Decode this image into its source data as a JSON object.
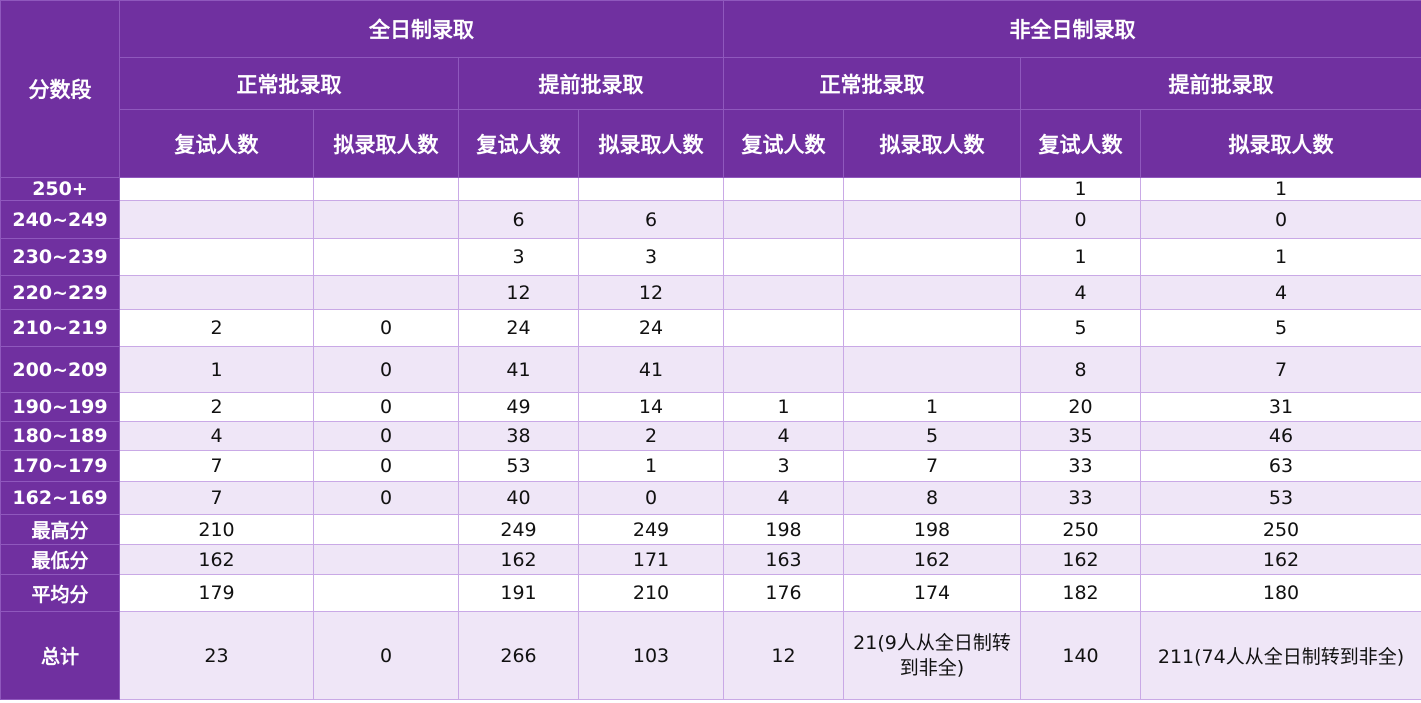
{
  "header": {
    "score_band": "分数段",
    "groups": [
      "全日制录取",
      "非全日制录取"
    ],
    "subgroups": [
      "正常批录取",
      "提前批录取",
      "正常批录取",
      "提前批录取"
    ],
    "columns": [
      "复试人数",
      "拟录取人数",
      "复试人数",
      "拟录取人数",
      "复试人数",
      "拟录取人数",
      "复试人数",
      "拟录取人数"
    ]
  },
  "rows": [
    {
      "label": "250+",
      "cells": [
        "",
        "",
        "",
        "",
        "",
        "",
        "1",
        "1"
      ]
    },
    {
      "label": "240~249",
      "cells": [
        "",
        "",
        "6",
        "6",
        "",
        "",
        "0",
        "0"
      ]
    },
    {
      "label": "230~239",
      "cells": [
        "",
        "",
        "3",
        "3",
        "",
        "",
        "1",
        "1"
      ]
    },
    {
      "label": "220~229",
      "cells": [
        "",
        "",
        "12",
        "12",
        "",
        "",
        "4",
        "4"
      ]
    },
    {
      "label": "210~219",
      "cells": [
        "2",
        "0",
        "24",
        "24",
        "",
        "",
        "5",
        "5"
      ]
    },
    {
      "label": "200~209",
      "cells": [
        "1",
        "0",
        "41",
        "41",
        "",
        "",
        "8",
        "7"
      ]
    },
    {
      "label": "190~199",
      "cells": [
        "2",
        "0",
        "49",
        "14",
        "1",
        "1",
        "20",
        "31"
      ]
    },
    {
      "label": "180~189",
      "cells": [
        "4",
        "0",
        "38",
        "2",
        "4",
        "5",
        "35",
        "46"
      ]
    },
    {
      "label": "170~179",
      "cells": [
        "7",
        "0",
        "53",
        "1",
        "3",
        "7",
        "33",
        "63"
      ]
    },
    {
      "label": "162~169",
      "cells": [
        "7",
        "0",
        "40",
        "0",
        "4",
        "8",
        "33",
        "53"
      ]
    },
    {
      "label": "最高分",
      "cells": [
        "210",
        "",
        "249",
        "249",
        "198",
        "198",
        "250",
        "250"
      ]
    },
    {
      "label": "最低分",
      "cells": [
        "162",
        "",
        "162",
        "171",
        "163",
        "162",
        "162",
        "162"
      ]
    },
    {
      "label": "平均分",
      "cells": [
        "179",
        "",
        "191",
        "210",
        "176",
        "174",
        "182",
        "180"
      ]
    },
    {
      "label": "总计",
      "cells": [
        "23",
        "0",
        "266",
        "103",
        "12",
        "21(9人从全日制转到非全)",
        "140",
        "211(74人从全日制转到非全)"
      ]
    }
  ],
  "colors": {
    "header_bg": "#7030a0",
    "stripe": "#efe6f7",
    "border": "#c9a9e6"
  }
}
